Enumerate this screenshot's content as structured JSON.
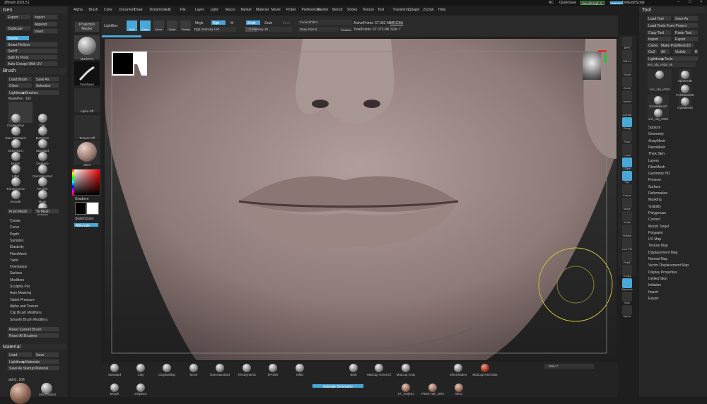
{
  "title": {
    "app": "ZBrush 2021.5 [",
    "ac": "AC",
    "quicksave": "QuickSave",
    "seethrough": "See-through 0",
    "menus_label": "Menus",
    "script": "DefaultZScript"
  },
  "menubar": [
    "Alpha",
    "Brush",
    "Color",
    "Document",
    "Draw",
    "Dynamics",
    "Edit",
    "File",
    "Layer",
    "Light",
    "Macro",
    "Marker",
    "Material",
    "Movie",
    "Picker",
    "Preferences",
    "Render",
    "Stencil",
    "Stroke",
    "Texture",
    "Tool",
    "Transform",
    "Zplugin",
    "Zscript",
    "Help"
  ],
  "left": {
    "gen_header": "Gen",
    "gen_buttons": [
      "Export",
      "Import",
      "Duplicate",
      "Append",
      "Insert",
      "Delete",
      "Split To Parts",
      "Smart ReSym",
      "DelHT",
      "Auto Groups With UV"
    ],
    "brush_header": "Brush",
    "brush_buttons": [
      "Load Brush",
      "Save As",
      "Clone",
      "Selection",
      "Lightbox▶Brushes"
    ],
    "brush_name": "MaskPen. 103",
    "brushes": [
      "MaskPen",
      "Clay",
      "ClayBuildup",
      "MaskPen",
      "Dam Standard",
      "Standard",
      "SelectRect",
      "Displace",
      "Morph",
      "DamStandard",
      "Inflat",
      "hPolish",
      "TrimDynamic",
      "Move",
      "Smooth",
      "Smooth"
    ],
    "brush_extra": [
      "From Mesh",
      "To Mesh"
    ],
    "brush_menu": [
      "Create",
      "Curve",
      "Depth",
      "Samples",
      "Elasticity",
      "FiberMesh",
      "Twist",
      "Orientation",
      "Surface",
      "Modifiers",
      "Sculptris Pro",
      "Auto Masking",
      "Tablet Pressure",
      "Alpha and Texture",
      "Clip Brush Modifiers",
      "Smooth Brush Modifiers"
    ],
    "brush_reset": [
      "Reset Current Brush",
      "Reset All Brushes"
    ],
    "material_header": "Material",
    "material_buttons": [
      "Load",
      "Save",
      "Lightbox▶Materials",
      "Save As Startup Material"
    ],
    "material_name": "skin1. 106",
    "material_labels": [
      "",
      "SkinShade4"
    ]
  },
  "shelf": {
    "projection": "Projection Master",
    "lightbox": "LightBox",
    "brush": "MaskPen",
    "stroke": "Freehand",
    "alpha": "Alpha Off",
    "texture": "Texture Off",
    "material": "skin1",
    "gradient": "Gradient",
    "switch": "SwitchColor",
    "alternate": "Alternate"
  },
  "toolbar": {
    "modes": [
      "Edit",
      "Draw",
      "Move",
      "Scale",
      "Rotate"
    ],
    "mrgb": "Mrgb",
    "rgb": "Rgb",
    "m": "M",
    "rgb_intensity": "Rgb Intensity 100",
    "zadd": "Zadd",
    "zsub": "Zsub",
    "zcut": "Zcut",
    "z_intensity": "Z Intensity 25",
    "focal": "Focal Shift 0",
    "drawsize": "Draw Size 5",
    "dynamic": "Dynamic",
    "active": "ActivePoints: 67.052 Mil",
    "totalpoints": "TotalPoints: 67.073 Mil",
    "mrgba": "MRGBA",
    "sdiv": "SDiv 7"
  },
  "right_strip": [
    "BPR",
    "SPix 4",
    "Scroll",
    "Zoom",
    "Actual",
    "AAHalf",
    "Persp",
    "Floor",
    "Local",
    "LSym",
    "Xyz",
    "Frame",
    "Move",
    "Scale",
    "Rotate",
    "Line Fill",
    "PolyF",
    "Transp",
    "Dynamic",
    "Solo",
    "Xpose"
  ],
  "tool": {
    "header": "Tool",
    "buttons": [
      "Load Tool",
      "Save As",
      "Load Tools From Project",
      "Copy Tool",
      "Paste Tool",
      "Import",
      "Export",
      "Clone",
      "Make PolyMesh3D",
      "GoZ",
      "All",
      "Visible",
      "R",
      "Lightbox▶Tools"
    ],
    "tool_name": "vnc_obj_v028. 48",
    "thumbs": [
      "vnc_obj_v028",
      "Sphere3D",
      "PolyMesh3D",
      "SimpleBrush",
      "Cylinder3D",
      "vnc_obj_v028"
    ],
    "menu": [
      "Subtool",
      "Geometry",
      "ArrayMesh",
      "NanoMesh",
      "Thick Skin",
      "Layers",
      "FiberMesh",
      "Geometry HD",
      "Preview",
      "Surface",
      "Deformation",
      "Masking",
      "Visibility",
      "Polygroups",
      "Contact",
      "Morph Target",
      "Polypaint",
      "UV Map",
      "Texture Map",
      "Displacement Map",
      "Normal Map",
      "Vector Displacement Map",
      "Display Properties",
      "Unified Skin",
      "Initialize",
      "Import",
      "Export"
    ]
  },
  "bottom": {
    "row1": [
      "Standard",
      "Clay",
      "ClayBuildup",
      "Move",
      "DamStandard",
      "TrimDynamic",
      "hPolish",
      "Inflat",
      "Blob",
      "MatCap GreenCl",
      "MatCap Gray",
      "SkinShade4",
      "SkinShade4",
      "MatCap Red Wax"
    ],
    "row2": [
      "Morph",
      "Displace",
      "ST_tmrjk01",
      "Flesh-Hair_Skin",
      "skin1"
    ],
    "activate": "Activate Symmetry",
    "sdiv": "SDiv 7"
  }
}
